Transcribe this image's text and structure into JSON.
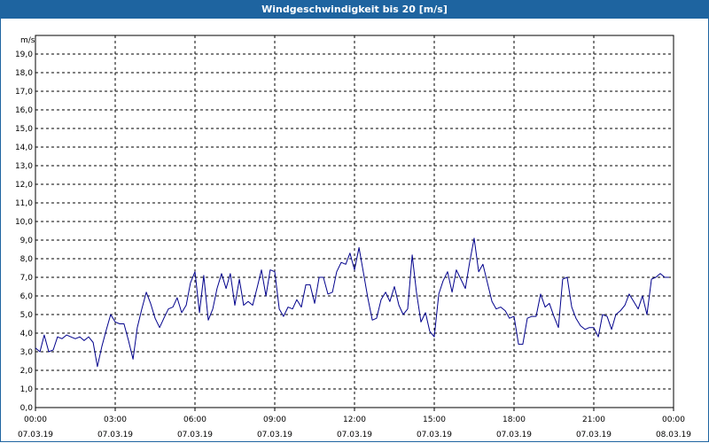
{
  "window": {
    "title": "Windgeschwindigkeit bis 20 [m/s]"
  },
  "chart_data": {
    "type": "line",
    "title": "Windgeschwindigkeit bis 20 [m/s]",
    "ylabel": "m/s",
    "ylim": [
      0,
      20
    ],
    "grid": true,
    "y_ticks": [
      "0,0",
      "1,0",
      "2,0",
      "3,0",
      "4,0",
      "5,0",
      "6,0",
      "7,0",
      "8,0",
      "9,0",
      "10,0",
      "11,0",
      "12,0",
      "13,0",
      "14,0",
      "15,0",
      "16,0",
      "17,0",
      "18,0",
      "19,0"
    ],
    "x_ticks": [
      {
        "time": "00:00",
        "date": "07.03.19"
      },
      {
        "time": "03:00",
        "date": "07.03.19"
      },
      {
        "time": "06:00",
        "date": "07.03.19"
      },
      {
        "time": "09:00",
        "date": "07.03.19"
      },
      {
        "time": "12:00",
        "date": "07.03.19"
      },
      {
        "time": "15:00",
        "date": "07.03.19"
      },
      {
        "time": "18:00",
        "date": "07.03.19"
      },
      {
        "time": "21:00",
        "date": "07.03.19"
      },
      {
        "time": "00:00",
        "date": "08.03.19"
      }
    ],
    "xlim_hours": [
      0,
      24
    ],
    "colors": {
      "line": "#00008b",
      "grid": "#000000"
    },
    "series": [
      {
        "x_hours": [
          0,
          0.17,
          0.33,
          0.5,
          0.67,
          0.83,
          1,
          1.17,
          1.33,
          1.5,
          1.67,
          1.83,
          2,
          2.17,
          2.33,
          2.5,
          2.67,
          2.83,
          3,
          3.17,
          3.33,
          3.5,
          3.67,
          3.83,
          4,
          4.17,
          4.33,
          4.5,
          4.67,
          4.83,
          5,
          5.17,
          5.33,
          5.5,
          5.67,
          5.83,
          6,
          6.17,
          6.33,
          6.5,
          6.67,
          6.83,
          7,
          7.17,
          7.33,
          7.5,
          7.67,
          7.83,
          8,
          8.17,
          8.33,
          8.5,
          8.67,
          8.83,
          9,
          9.17,
          9.33,
          9.5,
          9.67,
          9.83,
          10,
          10.17,
          10.33,
          10.5,
          10.67,
          10.83,
          11,
          11.17,
          11.33,
          11.5,
          11.67,
          11.83,
          12,
          12.17,
          12.33,
          12.5,
          12.67,
          12.83,
          13,
          13.17,
          13.33,
          13.5,
          13.67,
          13.83,
          14,
          14.17,
          14.33,
          14.5,
          14.67,
          14.83,
          15,
          15.17,
          15.33,
          15.5,
          15.67,
          15.83,
          16,
          16.17,
          16.33,
          16.5,
          16.67,
          16.83,
          17,
          17.17,
          17.33,
          17.5,
          17.67,
          17.83,
          18,
          18.17,
          18.33,
          18.5,
          18.67,
          18.83,
          19,
          19.17,
          19.33,
          19.5,
          19.67,
          19.83,
          20,
          20.17,
          20.33,
          20.5,
          20.67,
          20.83,
          21,
          21.17,
          21.33,
          21.5,
          21.67,
          21.83,
          22,
          22.17,
          22.33,
          22.5,
          22.67,
          22.83,
          23,
          23.17,
          23.33,
          23.5,
          23.67,
          23.83
        ],
        "values": [
          3.2,
          3.0,
          3.9,
          3.0,
          3.1,
          3.8,
          3.7,
          3.9,
          3.8,
          3.7,
          3.8,
          3.6,
          3.8,
          3.5,
          2.2,
          3.3,
          4.2,
          5.0,
          4.6,
          4.5,
          4.5,
          3.6,
          2.6,
          4.3,
          5.3,
          6.2,
          5.6,
          4.8,
          4.3,
          4.8,
          5.3,
          5.4,
          5.9,
          5.1,
          5.5,
          6.7,
          7.3,
          5.1,
          7.1,
          4.7,
          5.3,
          6.4,
          7.2,
          6.4,
          7.2,
          5.5,
          6.9,
          5.5,
          5.7,
          5.5,
          6.4,
          7.4,
          6.0,
          7.4,
          7.3,
          5.3,
          4.9,
          5.4,
          5.3,
          5.8,
          5.4,
          6.6,
          6.6,
          5.6,
          7.0,
          7.0,
          6.1,
          6.2,
          7.3,
          7.8,
          7.7,
          8.3,
          7.4,
          8.6,
          7.3,
          5.9,
          4.7,
          4.8,
          5.8,
          6.2,
          5.7,
          6.5,
          5.5,
          5.0,
          5.3,
          8.2,
          6.2,
          4.6,
          5.1,
          4.1,
          3.8,
          6.1,
          6.8,
          7.3,
          6.2,
          7.4,
          6.9,
          6.4,
          7.8,
          9.1,
          7.3,
          7.7,
          6.7,
          5.7,
          5.3,
          5.4,
          5.2,
          4.8,
          4.9,
          3.4,
          3.4,
          4.8,
          4.9,
          4.9,
          6.1,
          5.4,
          5.6,
          4.9,
          4.3,
          6.9,
          7.0,
          5.4,
          4.8,
          4.4,
          4.2,
          4.3,
          4.3,
          3.8,
          5.0,
          4.9,
          4.2,
          5.0,
          5.2,
          5.5,
          6.1,
          5.7,
          5.3,
          6.0,
          5.0,
          6.9,
          7.0,
          7.2,
          7.0,
          7.0
        ]
      }
    ]
  }
}
